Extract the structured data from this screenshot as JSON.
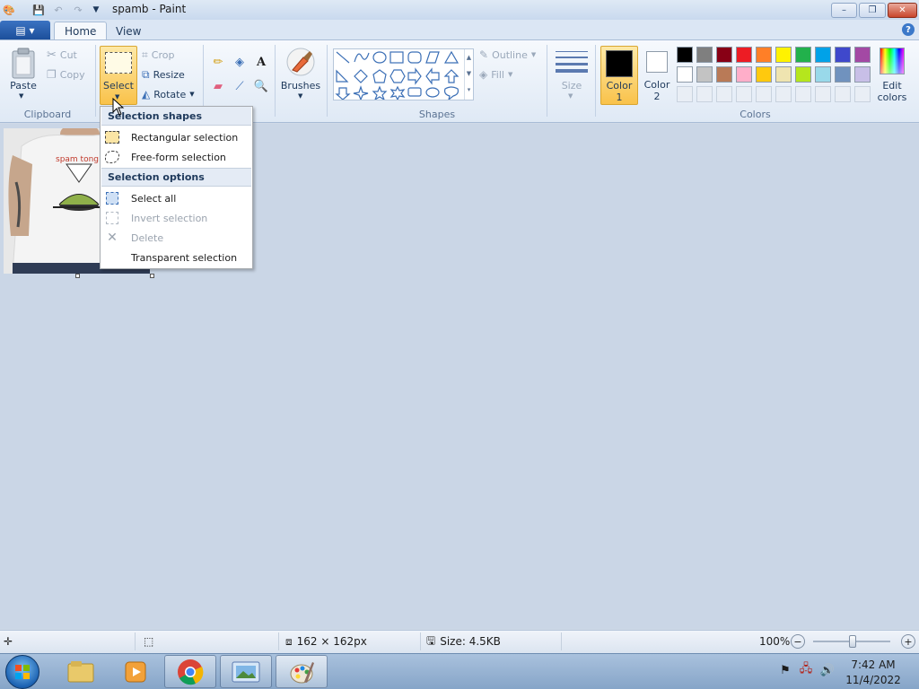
{
  "window": {
    "title": "spamb - Paint",
    "controls": {
      "minimize": "–",
      "maximize": "❐",
      "close": "✕"
    }
  },
  "tabs": [
    {
      "label": "Home",
      "active": true
    },
    {
      "label": "View",
      "active": false
    }
  ],
  "ribbon": {
    "clipboard": {
      "label": "Clipboard",
      "paste": "Paste",
      "cut": "Cut",
      "copy": "Copy"
    },
    "image": {
      "select": "Select",
      "crop": "Crop",
      "resize": "Resize",
      "rotate": "Rotate"
    },
    "tools": {
      "brushes": "Brushes"
    },
    "shapes": {
      "label": "Shapes",
      "outline": "Outline",
      "fill": "Fill"
    },
    "size": "Size",
    "colors": {
      "label": "Colors",
      "color1_line1": "Color",
      "color1_line2": "1",
      "color2_line1": "Color",
      "color2_line2": "2",
      "edit_line1": "Edit",
      "edit_line2": "colors",
      "color1_value": "#000000",
      "color2_value": "#ffffff",
      "palette_row1": [
        "#000000",
        "#7f7f7f",
        "#880015",
        "#ed1c24",
        "#ff7f27",
        "#fff200",
        "#22b14c",
        "#00a2e8",
        "#3f48cc",
        "#a349a4"
      ],
      "palette_row2": [
        "#ffffff",
        "#c3c3c3",
        "#b97a57",
        "#ffaec9",
        "#ffc90e",
        "#efe4b0",
        "#b5e61d",
        "#99d9ea",
        "#7092be",
        "#c8bfe7"
      ]
    }
  },
  "select_menu": {
    "shapes_header": "Selection shapes",
    "rectangular": "Rectangular selection",
    "freeform": "Free-form selection",
    "options_header": "Selection options",
    "select_all": "Select all",
    "invert": "Invert selection",
    "delete": "Delete",
    "transparent": "Transparent selection"
  },
  "picture": {
    "shirt_text": "spam tong"
  },
  "status": {
    "dimensions": "162 × 162px",
    "size": "Size: 4.5KB",
    "zoom": "100%"
  },
  "taskbar": {
    "time": "7:42 AM",
    "date": "11/4/2022"
  }
}
